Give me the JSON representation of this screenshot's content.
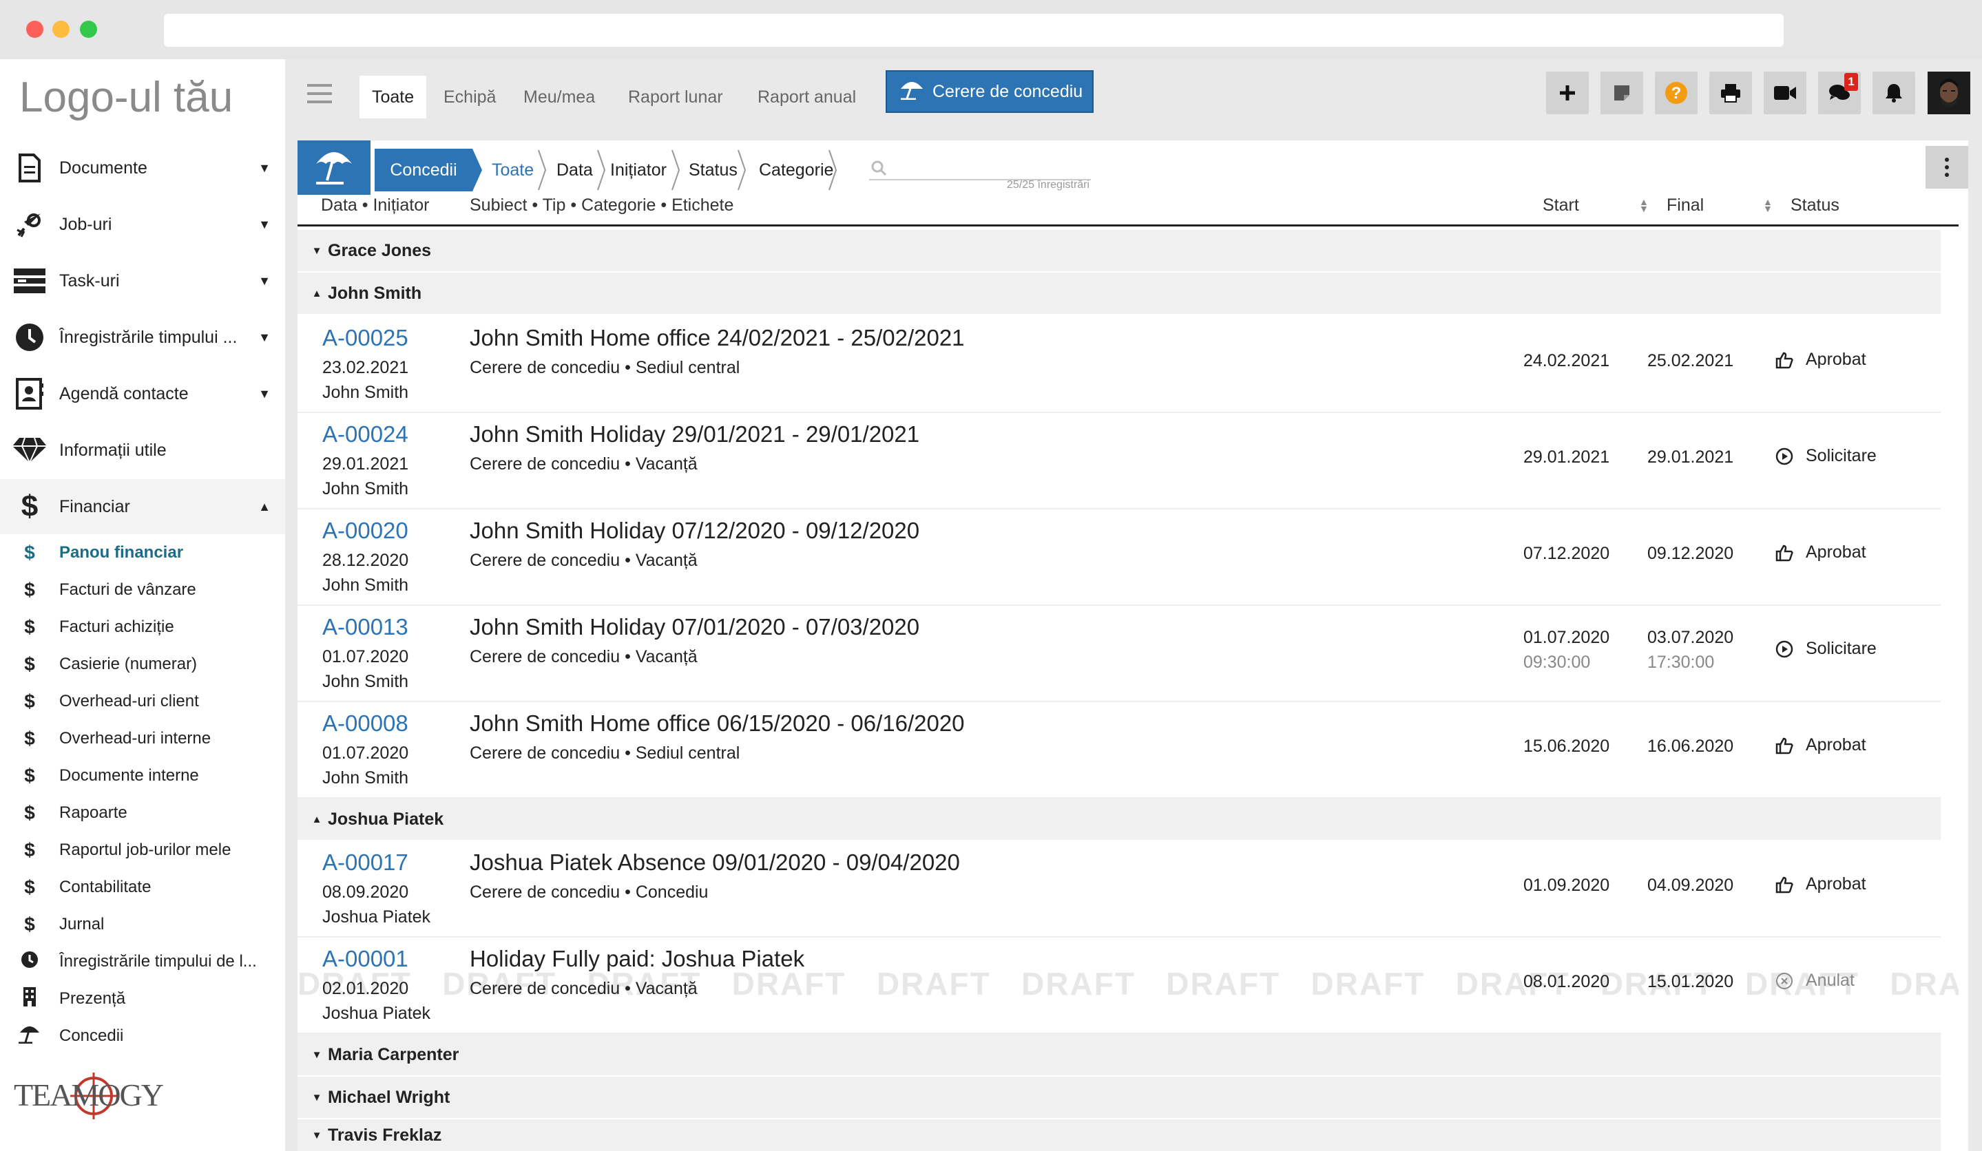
{
  "logo": "Logo-ul tău",
  "brand": "TEAMOGY",
  "sidebar": {
    "items": [
      {
        "label": "Documente",
        "icon": "document-icon"
      },
      {
        "label": "Job-uri",
        "icon": "rocket-icon"
      },
      {
        "label": "Task-uri",
        "icon": "tasks-icon"
      },
      {
        "label": "Înregistrările timpului ...",
        "icon": "clock-icon"
      },
      {
        "label": "Agendă contacte",
        "icon": "contacts-icon"
      },
      {
        "label": "Informații utile",
        "icon": "diamond-icon"
      },
      {
        "label": "Financiar",
        "icon": "dollar-icon"
      }
    ],
    "sub_items": [
      {
        "label": "Panou financiar",
        "icon": "dollar-icon",
        "active": true
      },
      {
        "label": "Facturi de vânzare",
        "icon": "dollar-icon"
      },
      {
        "label": "Facturi achiziție",
        "icon": "dollar-icon"
      },
      {
        "label": "Casierie (numerar)",
        "icon": "dollar-icon"
      },
      {
        "label": "Overhead-uri client",
        "icon": "dollar-icon"
      },
      {
        "label": "Overhead-uri interne",
        "icon": "dollar-icon"
      },
      {
        "label": "Documente interne",
        "icon": "dollar-icon"
      },
      {
        "label": "Rapoarte",
        "icon": "dollar-icon"
      },
      {
        "label": "Raportul job-urilor mele",
        "icon": "dollar-icon"
      },
      {
        "label": "Contabilitate",
        "icon": "dollar-icon"
      },
      {
        "label": "Jurnal",
        "icon": "dollar-icon"
      },
      {
        "label": "Înregistrările timpului de l...",
        "icon": "clock-icon"
      },
      {
        "label": "Prezență",
        "icon": "building-icon"
      },
      {
        "label": "Concedii",
        "icon": "umbrella-icon"
      }
    ]
  },
  "topbar": {
    "tabs": [
      "Toate",
      "Echipă",
      "Meu/mea",
      "Raport lunar",
      "Raport anual"
    ],
    "active_tab": "Toate",
    "request_button": "Cerere de concediu",
    "chat_badge": "1"
  },
  "breadcrumb": [
    "Concedii",
    "Toate",
    "Data",
    "Inițiator",
    "Status",
    "Categorie"
  ],
  "search": {
    "count": "25/25 înregistrări"
  },
  "columns": {
    "left": "Data • Inițiator",
    "subject": "Subiect • Tip • Categorie • Etichete",
    "start": "Start",
    "final": "Final",
    "status": "Status"
  },
  "groups": [
    {
      "name": "Grace Jones",
      "expanded": false
    },
    {
      "name": "John Smith",
      "expanded": true
    },
    {
      "name": "Joshua Piatek",
      "expanded": true
    },
    {
      "name": "Maria Carpenter",
      "expanded": false
    },
    {
      "name": "Michael Wright",
      "expanded": false
    },
    {
      "name": "Travis Freklaz",
      "expanded": false
    }
  ],
  "rows": [
    {
      "id": "A-00025",
      "date": "23.02.2021",
      "initiator": "John Smith",
      "subject": "John Smith Home office 24/02/2021 - 25/02/2021",
      "detail": "Cerere de concediu • Sediul central",
      "start": "24.02.2021",
      "start_time": "",
      "final": "25.02.2021",
      "final_time": "",
      "status": "Aprobat",
      "status_icon": "thumbs-up-icon"
    },
    {
      "id": "A-00024",
      "date": "29.01.2021",
      "initiator": "John Smith",
      "subject": "John Smith Holiday 29/01/2021 - 29/01/2021",
      "detail": "Cerere de concediu • Vacanță",
      "start": "29.01.2021",
      "start_time": "",
      "final": "29.01.2021",
      "final_time": "",
      "status": "Solicitare",
      "status_icon": "play-circle-icon"
    },
    {
      "id": "A-00020",
      "date": "28.12.2020",
      "initiator": "John Smith",
      "subject": "John Smith Holiday 07/12/2020 - 09/12/2020",
      "detail": "Cerere de concediu • Vacanță",
      "start": "07.12.2020",
      "start_time": "",
      "final": "09.12.2020",
      "final_time": "",
      "status": "Aprobat",
      "status_icon": "thumbs-up-icon"
    },
    {
      "id": "A-00013",
      "date": "01.07.2020",
      "initiator": "John Smith",
      "subject": "John Smith Holiday 07/01/2020 - 07/03/2020",
      "detail": "Cerere de concediu • Vacanță",
      "start": "01.07.2020",
      "start_time": "09:30:00",
      "final": "03.07.2020",
      "final_time": "17:30:00",
      "status": "Solicitare",
      "status_icon": "play-circle-icon"
    },
    {
      "id": "A-00008",
      "date": "01.07.2020",
      "initiator": "John Smith",
      "subject": "John Smith Home office 06/15/2020 - 06/16/2020",
      "detail": "Cerere de concediu • Sediul central",
      "start": "15.06.2020",
      "start_time": "",
      "final": "16.06.2020",
      "final_time": "",
      "status": "Aprobat",
      "status_icon": "thumbs-up-icon"
    },
    {
      "id": "A-00017",
      "date": "08.09.2020",
      "initiator": "Joshua Piatek",
      "subject": "Joshua Piatek Absence 09/01/2020 - 09/04/2020",
      "detail": "Cerere de concediu • Concediu",
      "start": "01.09.2020",
      "start_time": "",
      "final": "04.09.2020",
      "final_time": "",
      "status": "Aprobat",
      "status_icon": "thumbs-up-icon"
    },
    {
      "id": "A-00001",
      "date": "02.01.2020",
      "initiator": "Joshua Piatek",
      "subject": "Holiday Fully paid: Joshua Piatek",
      "detail": "Cerere de concediu • Vacanță",
      "start": "08.01.2020",
      "start_time": "",
      "final": "15.01.2020",
      "final_time": "",
      "status": "Anulat",
      "status_icon": "x-circle-icon",
      "watermark": "DRAFT"
    }
  ]
}
